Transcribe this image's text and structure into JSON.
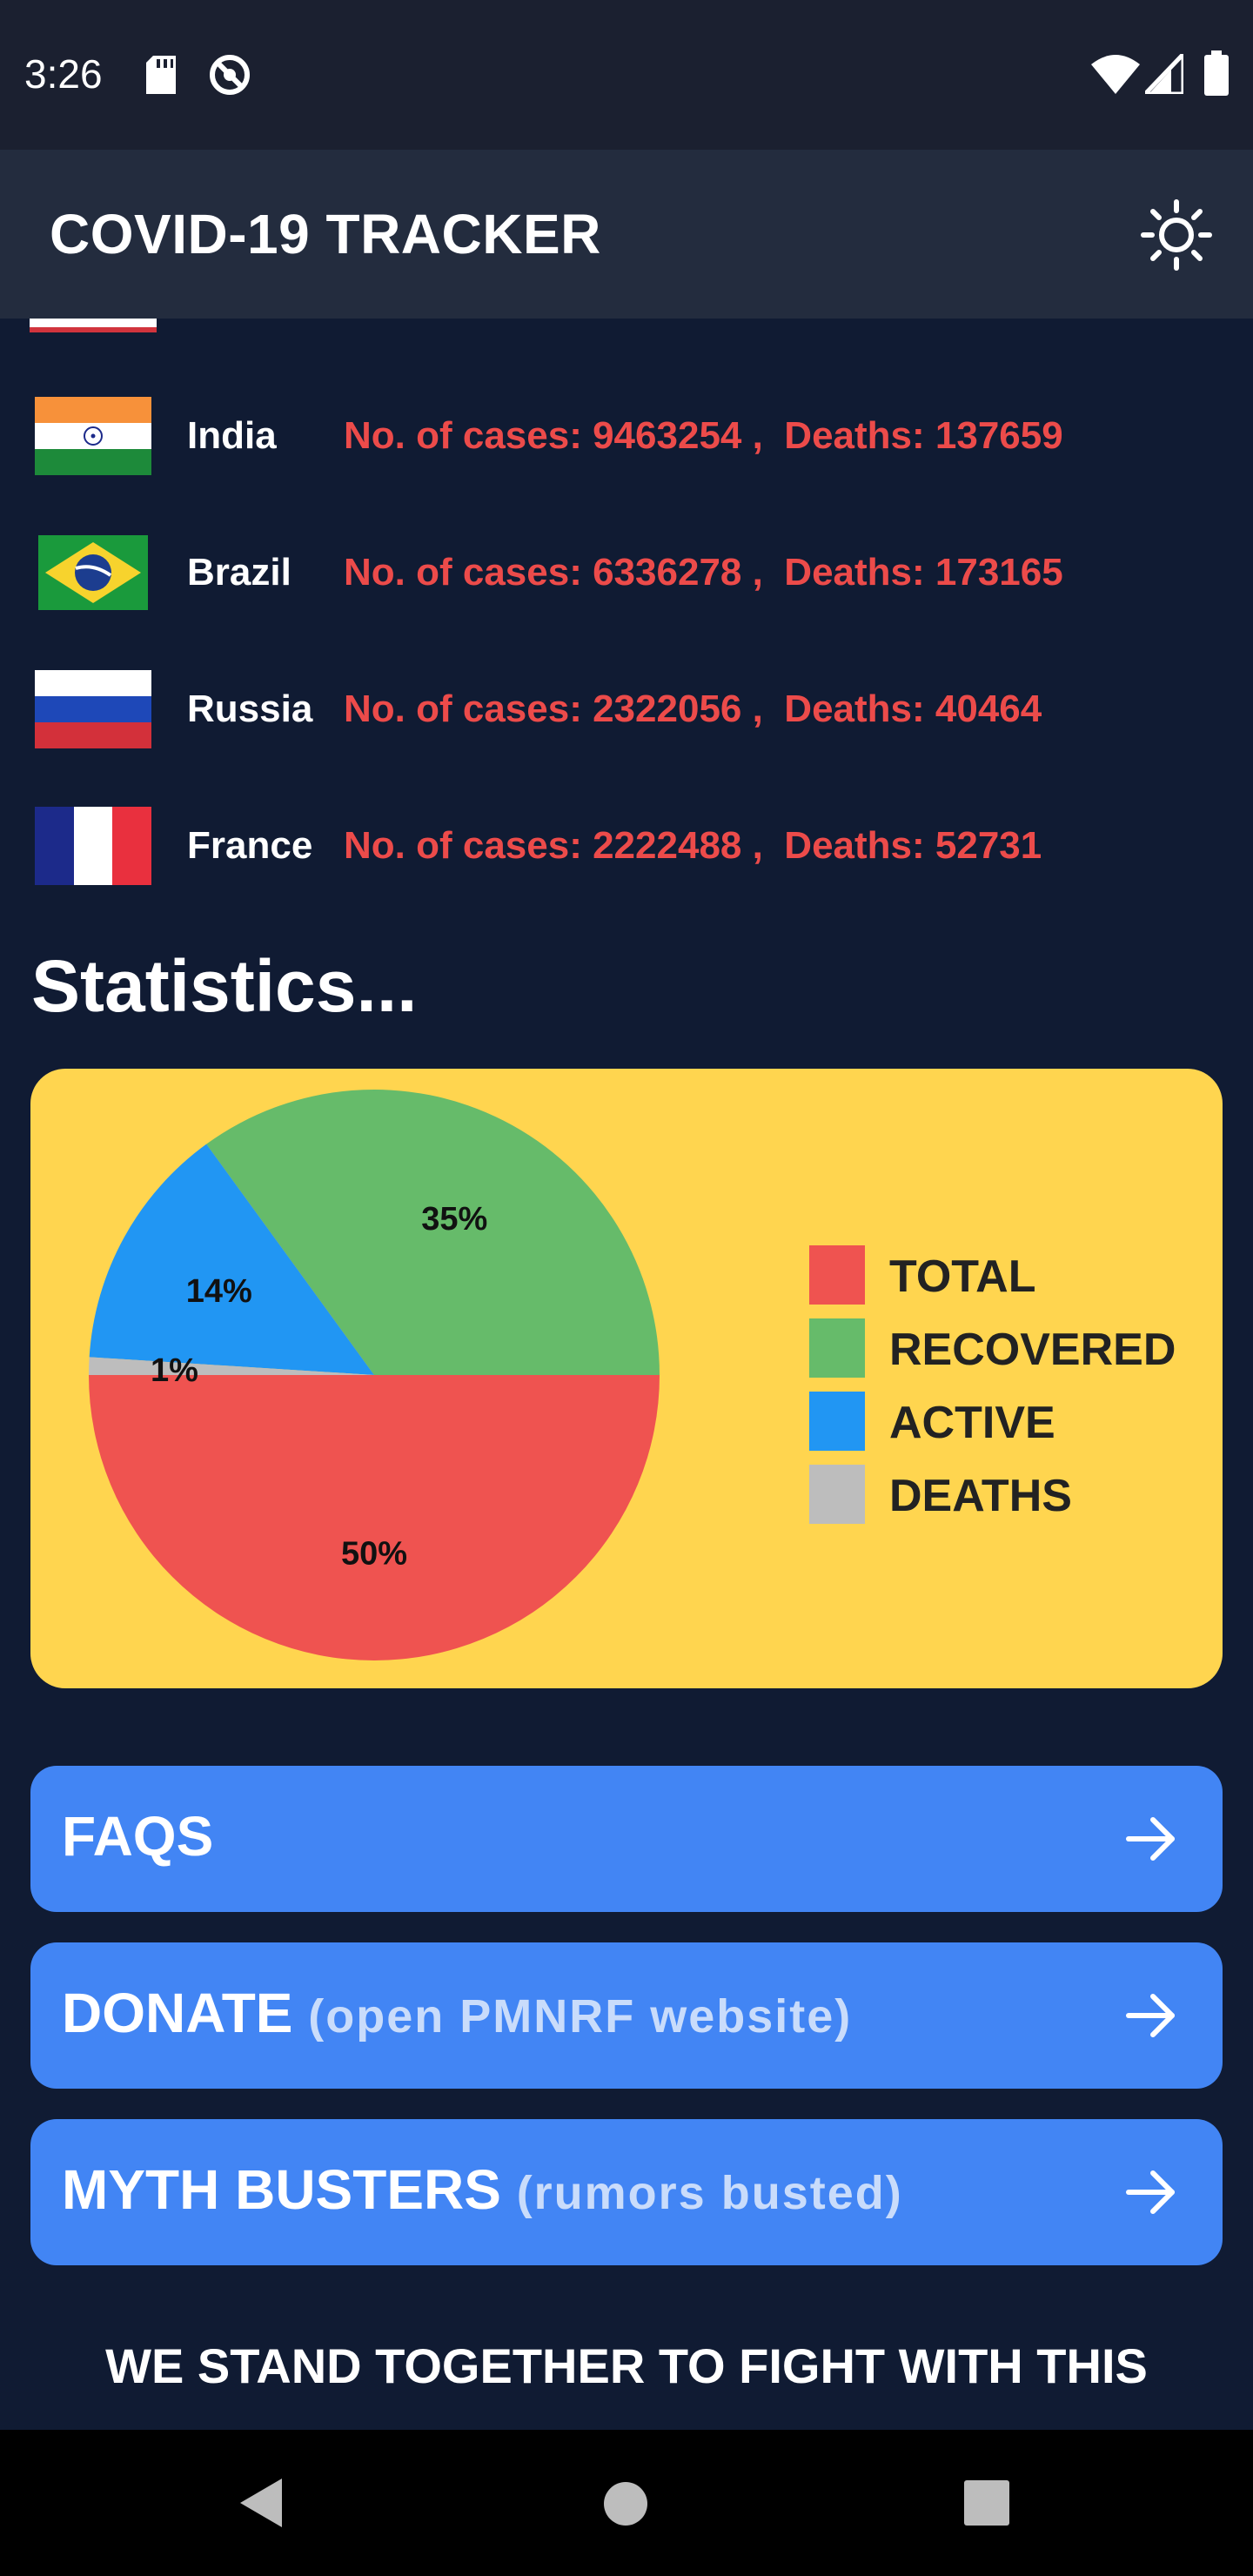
{
  "status_bar": {
    "time": "3:26",
    "left_icons": [
      "sd-card-icon",
      "no-sync-icon"
    ],
    "right_icons": [
      "wifi-icon",
      "signal-icon",
      "battery-icon"
    ]
  },
  "app_bar": {
    "title": "COVID-19 TRACKER",
    "theme_icon": "sun-icon"
  },
  "countries": [
    {
      "name": "India",
      "cases_label": "No. of cases: 9463254 ,",
      "deaths_label": "Deaths: 137659"
    },
    {
      "name": "Brazil",
      "cases_label": "No. of cases: 6336278 ,",
      "deaths_label": "Deaths: 173165"
    },
    {
      "name": "Russia",
      "cases_label": "No. of cases: 2322056 ,",
      "deaths_label": "Deaths: 40464"
    },
    {
      "name": "France",
      "cases_label": "No. of cases: 2222488 ,",
      "deaths_label": "Deaths: 52731"
    }
  ],
  "statistics": {
    "heading": "Statistics..."
  },
  "chart_data": {
    "type": "pie",
    "title": "",
    "slices": [
      {
        "label": "TOTAL",
        "value": 50,
        "display": "50%",
        "color": "#ef5350"
      },
      {
        "label": "RECOVERED",
        "value": 35,
        "display": "35%",
        "color": "#66bb6a"
      },
      {
        "label": "ACTIVE",
        "value": 14,
        "display": "14%",
        "color": "#2196f3"
      },
      {
        "label": "DEATHS",
        "value": 1,
        "display": "1%",
        "color": "#bdbdbd"
      }
    ],
    "legend": [
      "TOTAL",
      "RECOVERED",
      "ACTIVE",
      "DEATHS"
    ],
    "legend_position": "right"
  },
  "buttons": [
    {
      "label": "FAQS",
      "sub": "",
      "icon": "arrow-right-icon"
    },
    {
      "label": "DONATE",
      "sub": "(open PMNRF website)",
      "icon": "arrow-right-icon"
    },
    {
      "label": "MYTH BUSTERS",
      "sub": "(rumors busted)",
      "icon": "arrow-right-icon"
    }
  ],
  "footer": {
    "text": "WE STAND TOGETHER TO FIGHT WITH THIS"
  },
  "nav_bar": {
    "icons": [
      "back-icon",
      "home-icon",
      "recents-icon"
    ]
  },
  "colors": {
    "background": "#101b33",
    "app_bar": "#232c3e",
    "case_text": "#ec4b4a",
    "card": "#ffd54f",
    "button": "#4285f4"
  }
}
